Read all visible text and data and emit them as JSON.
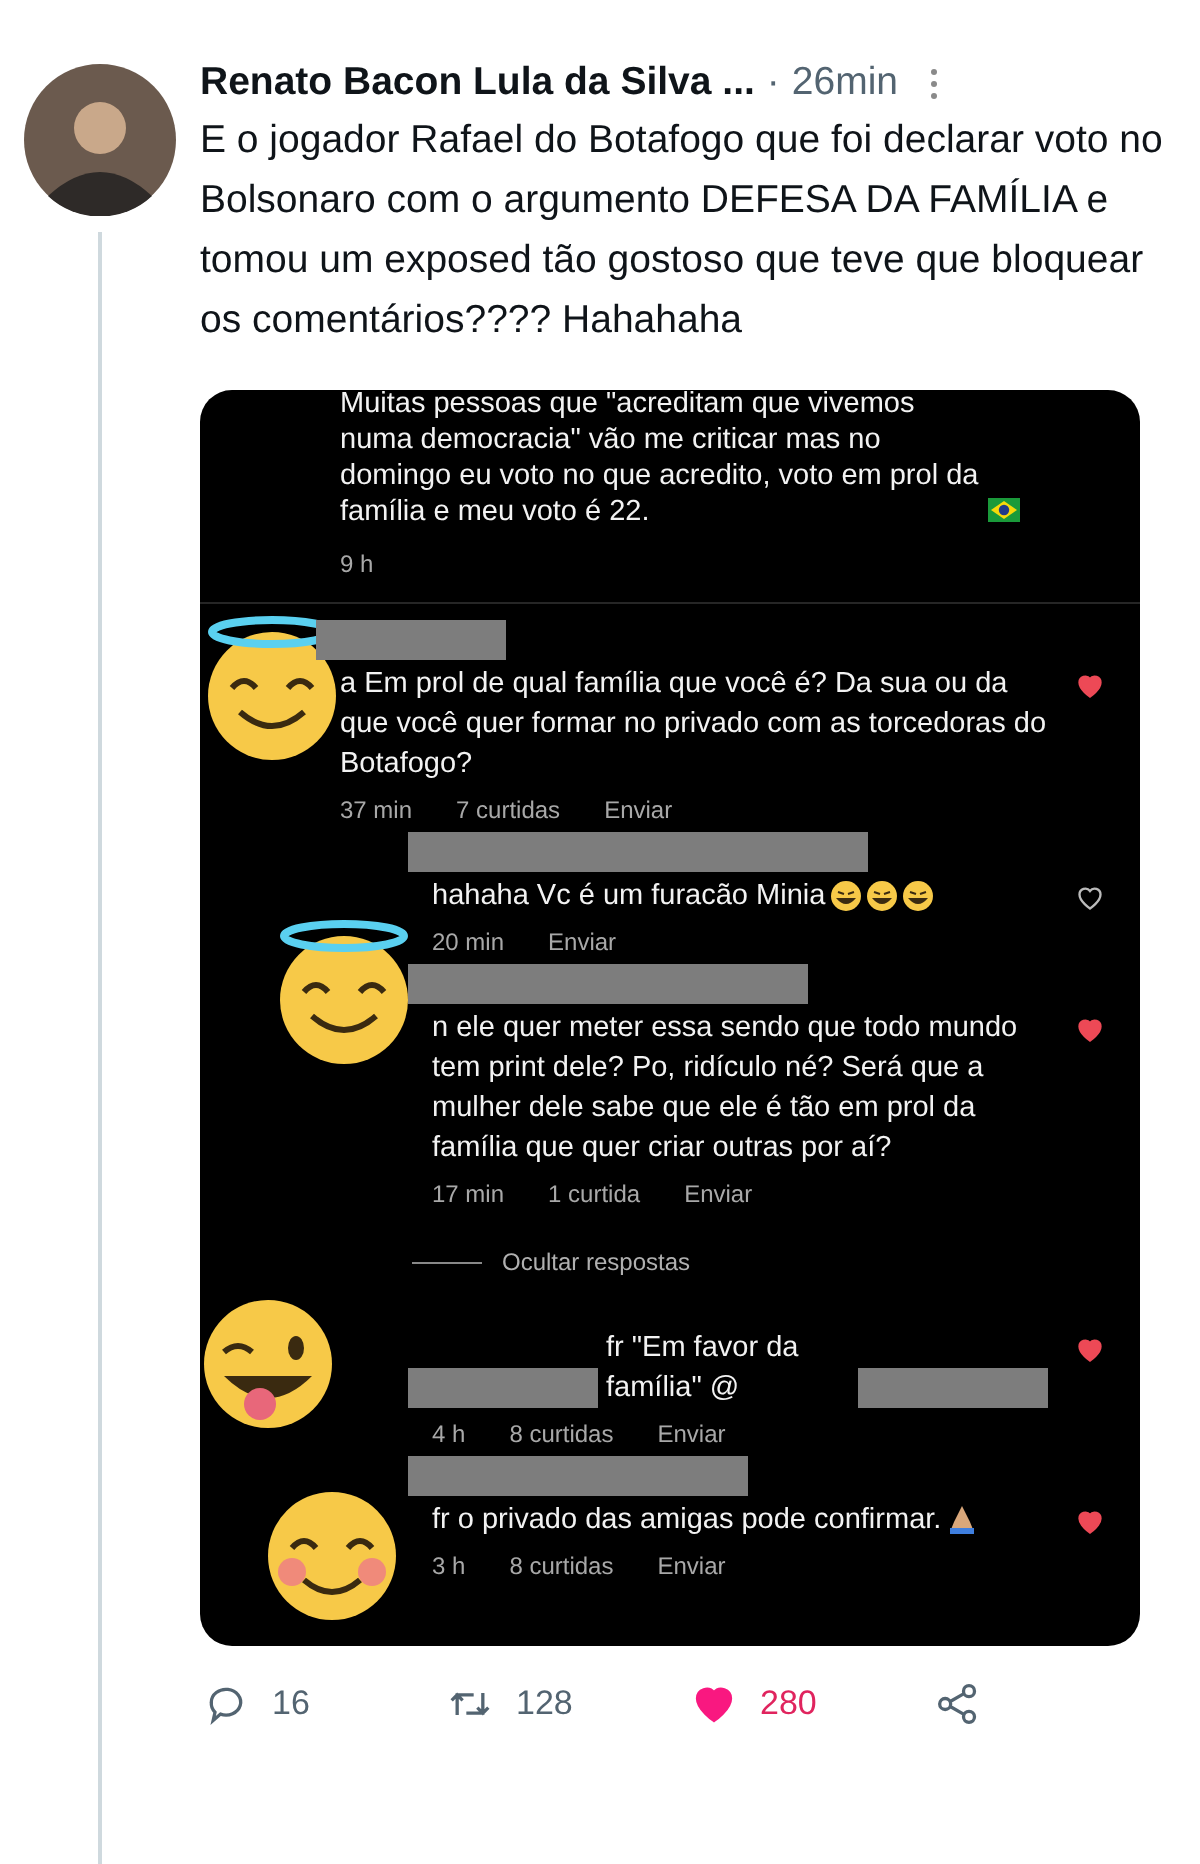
{
  "tweet": {
    "author": "Renato Bacon Lula da Silva ...",
    "separator": "·",
    "time": "26min",
    "text": "E o jogador Rafael do Botafogo que foi declarar voto no Bolsonaro com o argumento DEFESA DA FAMÍLIA e tomou um exposed tão gostoso que teve que bloquear os comentários???? Hahahaha"
  },
  "screenshot": {
    "caption": "Muitas pessoas que \"acreditam que vivemos numa democracia\" vão me criticar mas no domingo eu voto no que acredito, voto em prol da família e meu voto é 22.",
    "caption_time": "9 h",
    "comments": [
      {
        "reply": false,
        "text": "a Em prol de qual família que você é? Da sua ou da que você quer formar no privado com as torcedoras do Botafogo?",
        "meta": [
          "37 min",
          "7 curtidas",
          "Enviar"
        ],
        "liked": true
      },
      {
        "reply": true,
        "text": "hahaha Vc é um furacão Minia",
        "meta": [
          "20 min",
          "Enviar"
        ],
        "liked": false
      },
      {
        "reply": true,
        "text": "n ele quer meter essa sendo que todo mundo tem print dele? Po, ridículo né? Será que a mulher dele sabe que ele é tão em prol da família que quer criar outras por aí?",
        "meta": [
          "17 min",
          "1 curtida",
          "Enviar"
        ],
        "liked": true
      },
      {
        "reply": true,
        "kind": "toggle",
        "text": "Ocultar respostas"
      },
      {
        "reply": true,
        "text": "fr \"Em favor da família\" @",
        "meta": [
          "4 h",
          "8 curtidas",
          "Enviar"
        ],
        "liked": true
      },
      {
        "reply": true,
        "text": "fr o privado das amigas pode confirmar.",
        "meta": [
          "3 h",
          "8 curtidas",
          "Enviar"
        ],
        "liked": true
      }
    ]
  },
  "actions": [
    {
      "kind": "reply",
      "count": "16"
    },
    {
      "kind": "retweet",
      "count": "128"
    },
    {
      "kind": "like",
      "count": "280",
      "selected": true
    },
    {
      "kind": "share"
    }
  ]
}
